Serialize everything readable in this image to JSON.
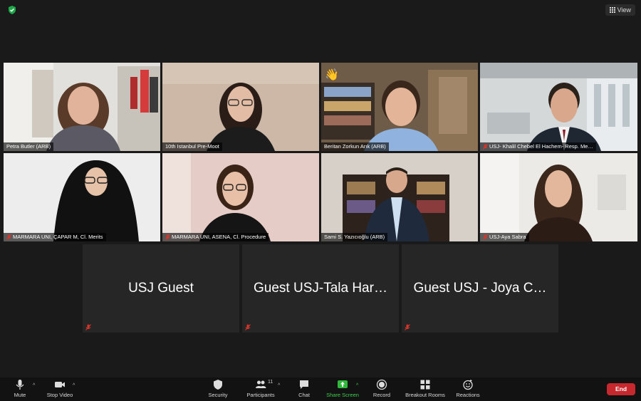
{
  "header": {
    "view_label": "View"
  },
  "participants": [
    {
      "name": "Petra Butler (ARB)",
      "muted": false
    },
    {
      "name": "10th Istanbul Pre-Moot",
      "muted": false
    },
    {
      "name": "Beritan Zorkun Arık (ARB)",
      "muted": false
    },
    {
      "name": "USJ- Khalil Chebel El Hachem- Resp. Me…",
      "muted": true,
      "active_speaker": true
    },
    {
      "name": "MARMARA UNI, ÇAPAR M, Cl. Merits",
      "muted": true
    },
    {
      "name": "MARMARA UNI, ASENA, Cl. Procedure",
      "muted": true
    },
    {
      "name": "Sami S. Yazıcıoğlu (ARB)",
      "muted": false
    },
    {
      "name": "USJ-Aya Sabra",
      "muted": true
    }
  ],
  "guests": [
    {
      "name": "USJ Guest"
    },
    {
      "name": "Guest USJ-Tala Har…"
    },
    {
      "name": "Guest USJ - Joya C…"
    }
  ],
  "toolbar": {
    "mute_label": "Mute",
    "stop_video_label": "Stop Video",
    "security_label": "Security",
    "participants_label": "Participants",
    "participants_count": "11",
    "chat_label": "Chat",
    "share_screen_label": "Share Screen",
    "record_label": "Record",
    "breakout_label": "Breakout Rooms",
    "reactions_label": "Reactions",
    "end_label": "End"
  },
  "colors": {
    "background": "#1a1a1a",
    "active_speaker_outline": "#c9d96a",
    "share_screen_green": "#2fb83b",
    "end_red": "#c7282d",
    "muted_red": "#d9342b"
  }
}
